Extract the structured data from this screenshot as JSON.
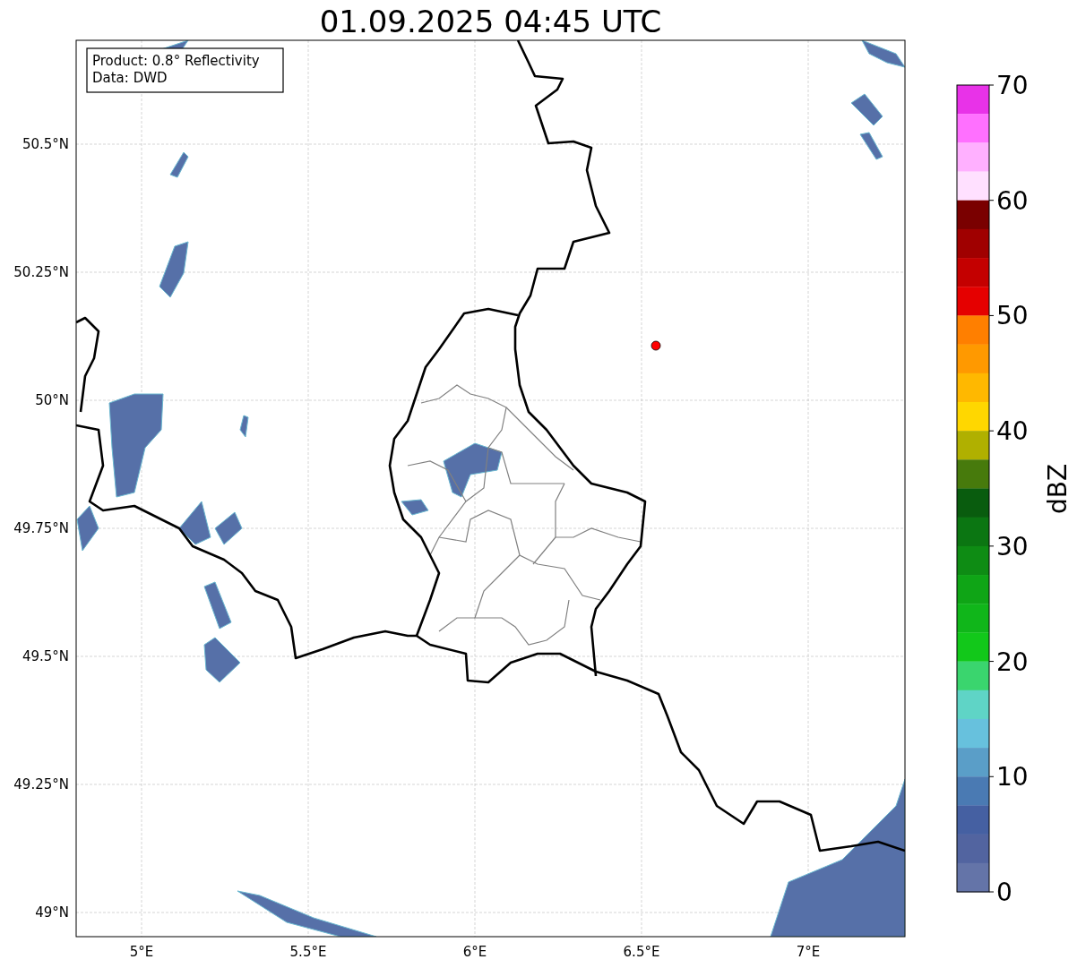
{
  "title": "01.09.2025 04:45 UTC",
  "info_box": {
    "lines": [
      "Product: 0.8° Reflectivity",
      "Data: DWD"
    ]
  },
  "map": {
    "lat_labels": [
      "50.5°N",
      "50.25°N",
      "50°N",
      "49.75°N",
      "49.5°N",
      "49.25°N",
      "49°N"
    ],
    "lon_labels": [
      "5°E",
      "5.5°E",
      "6°E",
      "6.5°E",
      "7°E"
    ]
  },
  "colorbar": {
    "label": "dBZ",
    "ticks": [
      "70",
      "60",
      "50",
      "40",
      "30",
      "20",
      "10",
      "0"
    ],
    "bins": [
      {
        "color": "#e832e8"
      },
      {
        "color": "#ff70ff"
      },
      {
        "color": "#ffb0ff"
      },
      {
        "color": "#ffe0ff"
      },
      {
        "color": "#7a0000"
      },
      {
        "color": "#a00000"
      },
      {
        "color": "#c40000"
      },
      {
        "color": "#e50000"
      },
      {
        "color": "#ff7f00"
      },
      {
        "color": "#ff9900"
      },
      {
        "color": "#ffb800"
      },
      {
        "color": "#ffd700"
      },
      {
        "color": "#b0b000"
      },
      {
        "color": "#477a0c"
      },
      {
        "color": "#095c0e"
      },
      {
        "color": "#0b7612"
      },
      {
        "color": "#0e8c14"
      },
      {
        "color": "#0fa516"
      },
      {
        "color": "#10b61a"
      },
      {
        "color": "#12c81a"
      },
      {
        "color": "#3ad56e"
      },
      {
        "color": "#5fd4c6"
      },
      {
        "color": "#67c1dd"
      },
      {
        "color": "#5a9ec8"
      },
      {
        "color": "#4a7ab3"
      },
      {
        "color": "#4560a2"
      },
      {
        "color": "#5264a0"
      },
      {
        "color": "#6474a8"
      }
    ]
  }
}
